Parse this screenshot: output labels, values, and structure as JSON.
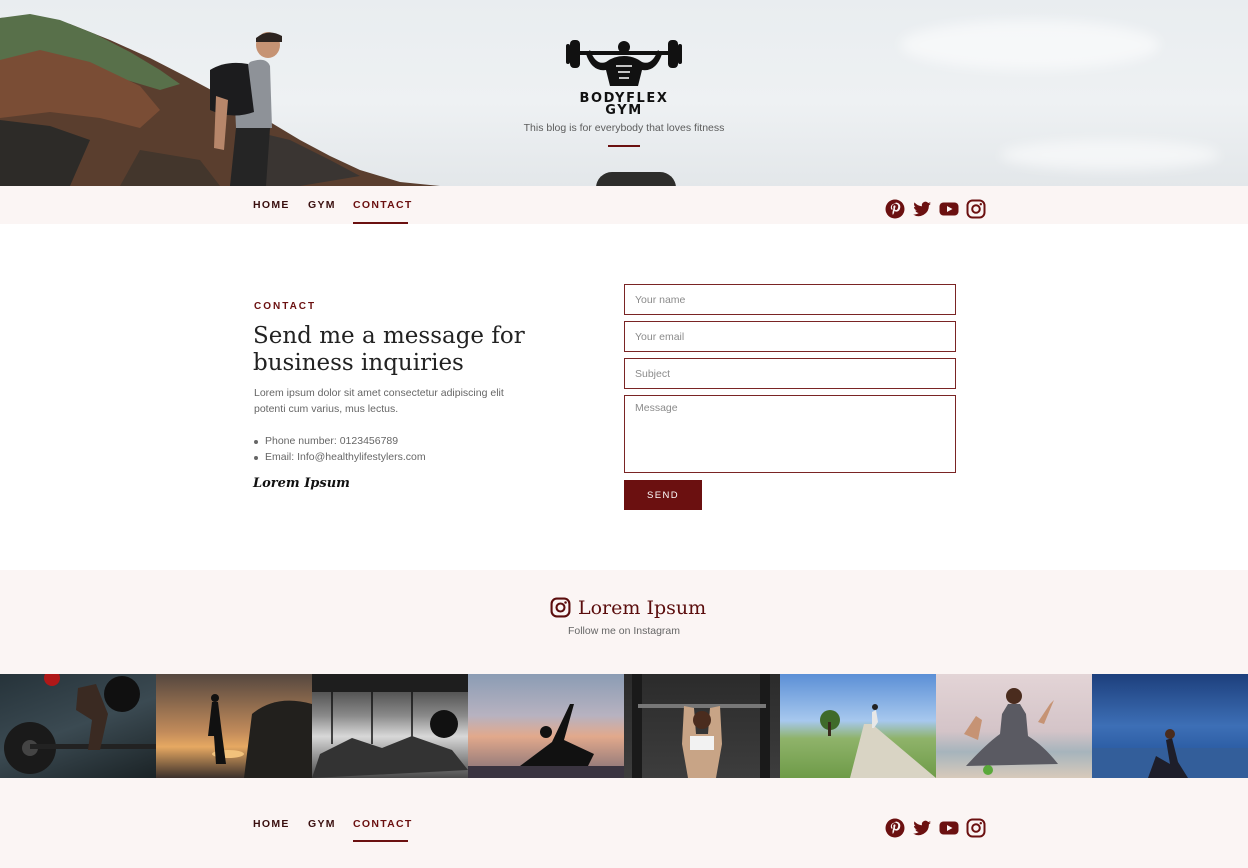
{
  "brand": {
    "logo_line1": "BODYFLEX",
    "logo_line2": "GYM",
    "tagline": "This blog is for everybody that loves fitness"
  },
  "nav": {
    "items": [
      {
        "label": "HOME",
        "active": false
      },
      {
        "label": "GYM",
        "active": false
      },
      {
        "label": "CONTACT",
        "active": true
      }
    ]
  },
  "social": [
    "pinterest-icon",
    "twitter-icon",
    "youtube-icon",
    "instagram-icon"
  ],
  "colors": {
    "accent": "#6b1010",
    "band_bg": "#fbf5f4"
  },
  "contact": {
    "kicker": "CONTACT",
    "heading": "Send me a message for business inquiries",
    "paragraph": "Lorem ipsum dolor sit amet consectetur adipiscing elit potenti cum varius, mus lectus.",
    "bullets": [
      "Phone number: 0123456789",
      "Email: Info@healthylifestylers.com"
    ],
    "signature": "Lorem Ipsum"
  },
  "form": {
    "name_placeholder": "Your name",
    "email_placeholder": "Your email",
    "subject_placeholder": "Subject",
    "message_placeholder": "Message",
    "send_label": "SEND"
  },
  "instagram": {
    "title": "Lorem Ipsum",
    "subtitle": "Follow me on Instagram",
    "photos": [
      "barbell-deadlift",
      "yoga-sunset-beach",
      "gym-interior",
      "yoga-pose-sunset",
      "woman-lifting-barbell",
      "runner-country-road",
      "woman-meditating-beach",
      "woman-stretching-sea"
    ]
  },
  "footer": {
    "items": [
      {
        "label": "HOME",
        "active": false
      },
      {
        "label": "GYM",
        "active": false
      },
      {
        "label": "CONTACT",
        "active": true
      }
    ]
  }
}
